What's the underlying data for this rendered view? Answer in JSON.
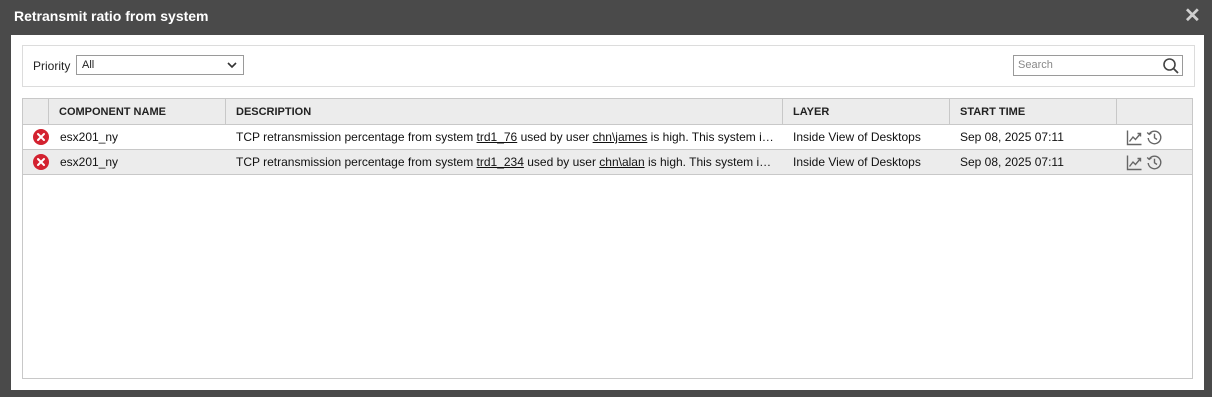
{
  "window": {
    "title": "Retransmit ratio from system",
    "close_label": "✕"
  },
  "filter": {
    "priority_label": "Priority",
    "priority_value": "All",
    "search_placeholder": "Search"
  },
  "table": {
    "headers": {
      "component": "COMPONENT NAME",
      "description": "DESCRIPTION",
      "layer": "LAYER",
      "start_time": "START TIME"
    },
    "rows": [
      {
        "severity": "critical",
        "component": "esx201_ny",
        "desc_pre": "TCP retransmission percentage from system ",
        "desc_sys": "trd1_76",
        "desc_mid": " used by user ",
        "desc_user": "chn\\james",
        "desc_post": " is high. This system i…",
        "layer": "Inside View of Desktops",
        "start_time": "Sep 08, 2025 07:11"
      },
      {
        "severity": "critical",
        "component": "esx201_ny",
        "desc_pre": "TCP retransmission percentage from system ",
        "desc_sys": "trd1_234",
        "desc_mid": " used by user ",
        "desc_user": "chn\\alan",
        "desc_post": " is high. This system i…",
        "layer": "Inside View of Desktops",
        "start_time": "Sep 08, 2025 07:11"
      }
    ]
  },
  "colors": {
    "critical": "#d32230",
    "header_bg": "#ececec",
    "chrome": "#4a4a4a"
  },
  "icons": [
    "close-icon",
    "chevron-down-icon",
    "search-icon",
    "critical-status-icon",
    "trend-graph-icon",
    "history-icon"
  ]
}
